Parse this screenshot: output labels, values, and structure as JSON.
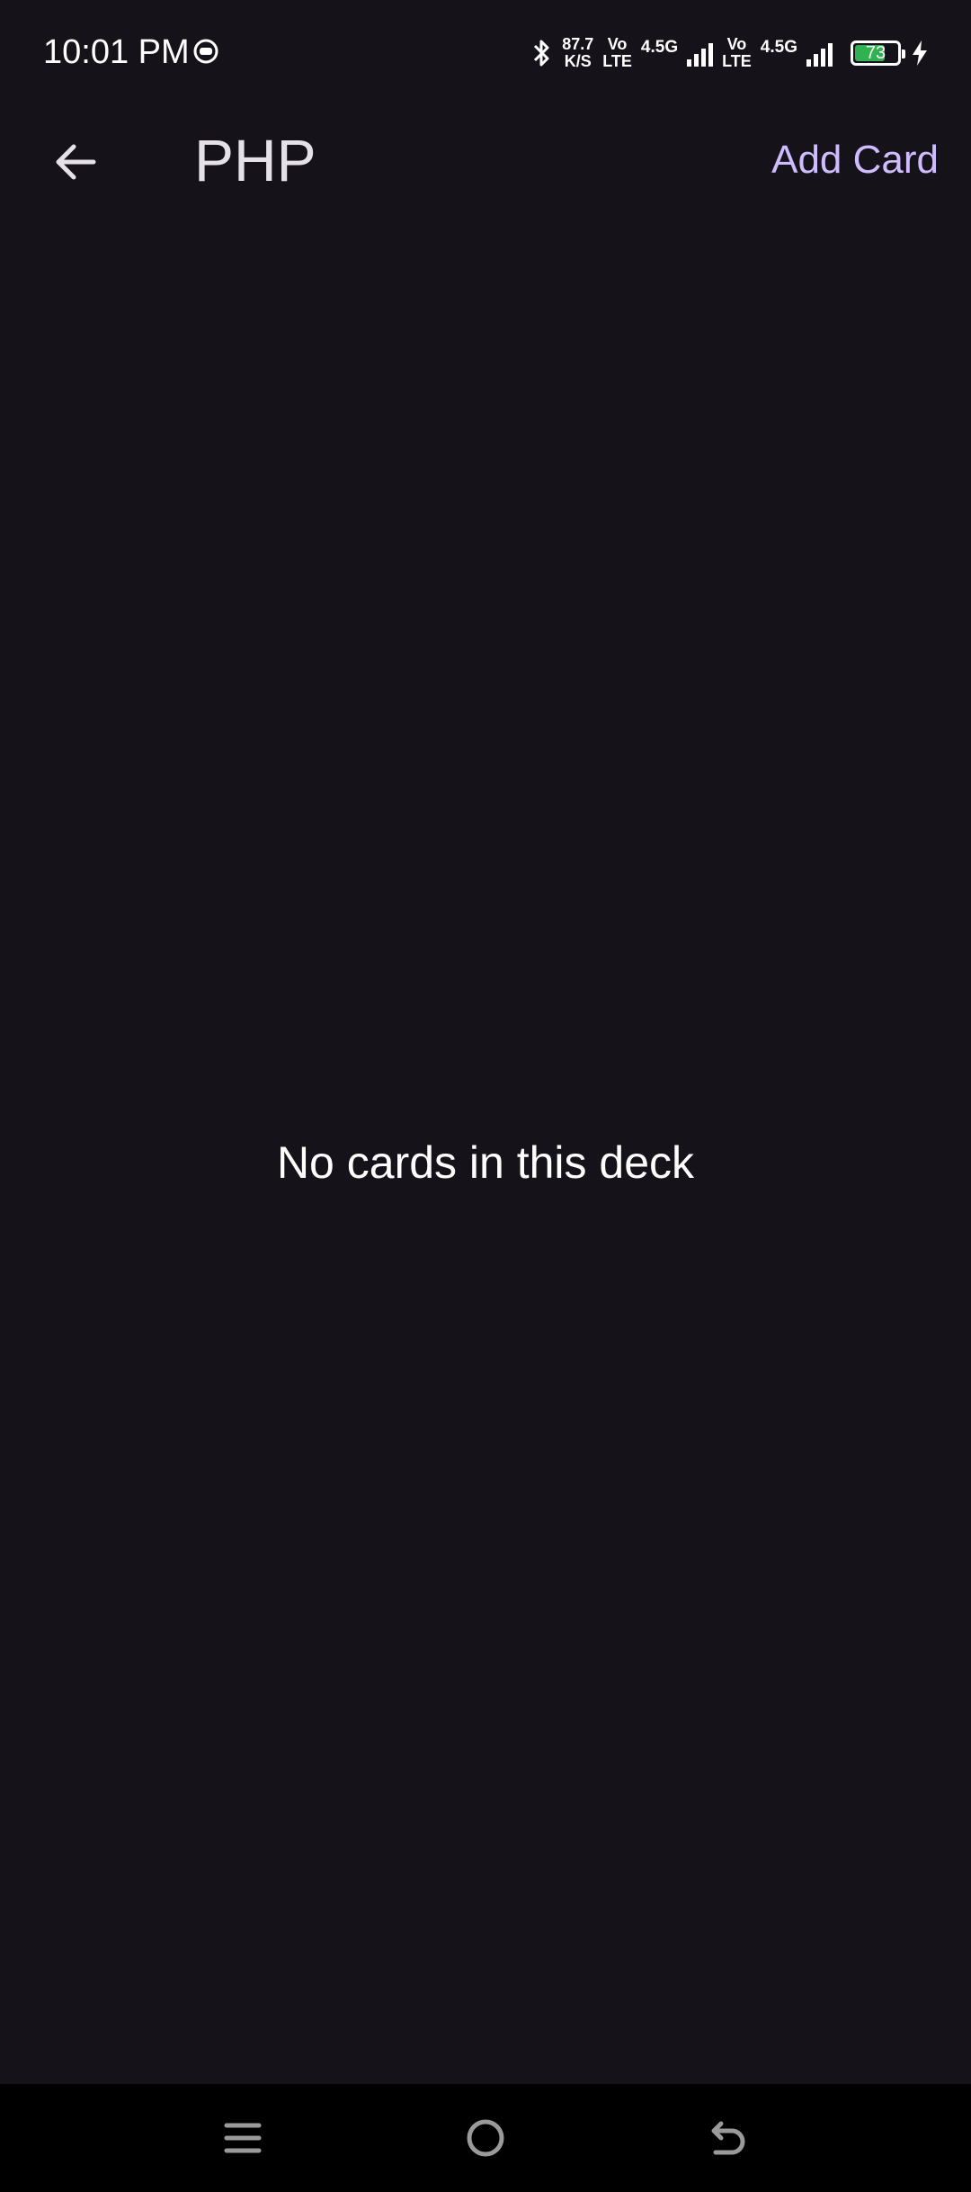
{
  "status_bar": {
    "time": "10:01 PM",
    "net_speed_value": "87.7",
    "net_speed_unit": "K/S",
    "sim1_vo": "Vo",
    "sim1_lte": "LTE",
    "sim1_net": "4.5G",
    "sim2_vo": "Vo",
    "sim2_lte": "LTE",
    "sim2_net": "4.5G",
    "battery_level": "73",
    "battery_fraction": 0.73,
    "icons": [
      "notification-face-icon",
      "bluetooth-icon",
      "signal-icon",
      "battery-icon",
      "charging-icon"
    ]
  },
  "app_bar": {
    "title": "PHP",
    "add_card_label": "Add Card"
  },
  "main": {
    "empty_message": "No cards in this deck"
  },
  "nav_bar": {
    "icons": [
      "menu-icon",
      "home-icon",
      "back-icon"
    ]
  },
  "colors": {
    "background": "#151319",
    "accent": "#cfbcff",
    "battery": "#2fb24f"
  }
}
